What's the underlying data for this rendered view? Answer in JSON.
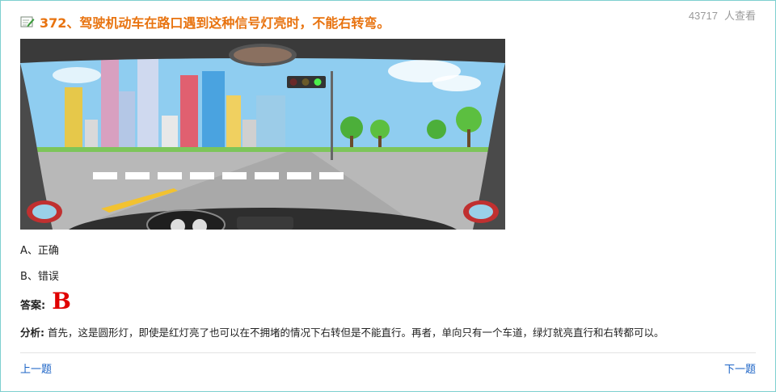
{
  "meta": {
    "view_count": "43717",
    "view_suffix": "人查看"
  },
  "question": {
    "title": "372、驾驶机动车在路口遇到这种信号灯亮时，不能右转弯。",
    "image_alt": "驾驶舱视角：前方路口信号灯（绿灯亮）"
  },
  "options": [
    {
      "label": "A、正确"
    },
    {
      "label": "B、错误"
    }
  ],
  "answer": {
    "label": "答案:",
    "value": "B"
  },
  "analysis": {
    "label": "分析:",
    "text": "首先，这是圆形灯，即使是红灯亮了也可以在不拥堵的情况下右转但是不能直行。再者，单向只有一个车道，绿灯就亮直行和右转都可以。"
  },
  "navigation": {
    "prev_label": "上一题",
    "next_label": "下一题"
  },
  "colors": {
    "title": "#e8730f",
    "answer": "#e00000",
    "link": "#1b63c6",
    "border": "#7ecfcf"
  }
}
